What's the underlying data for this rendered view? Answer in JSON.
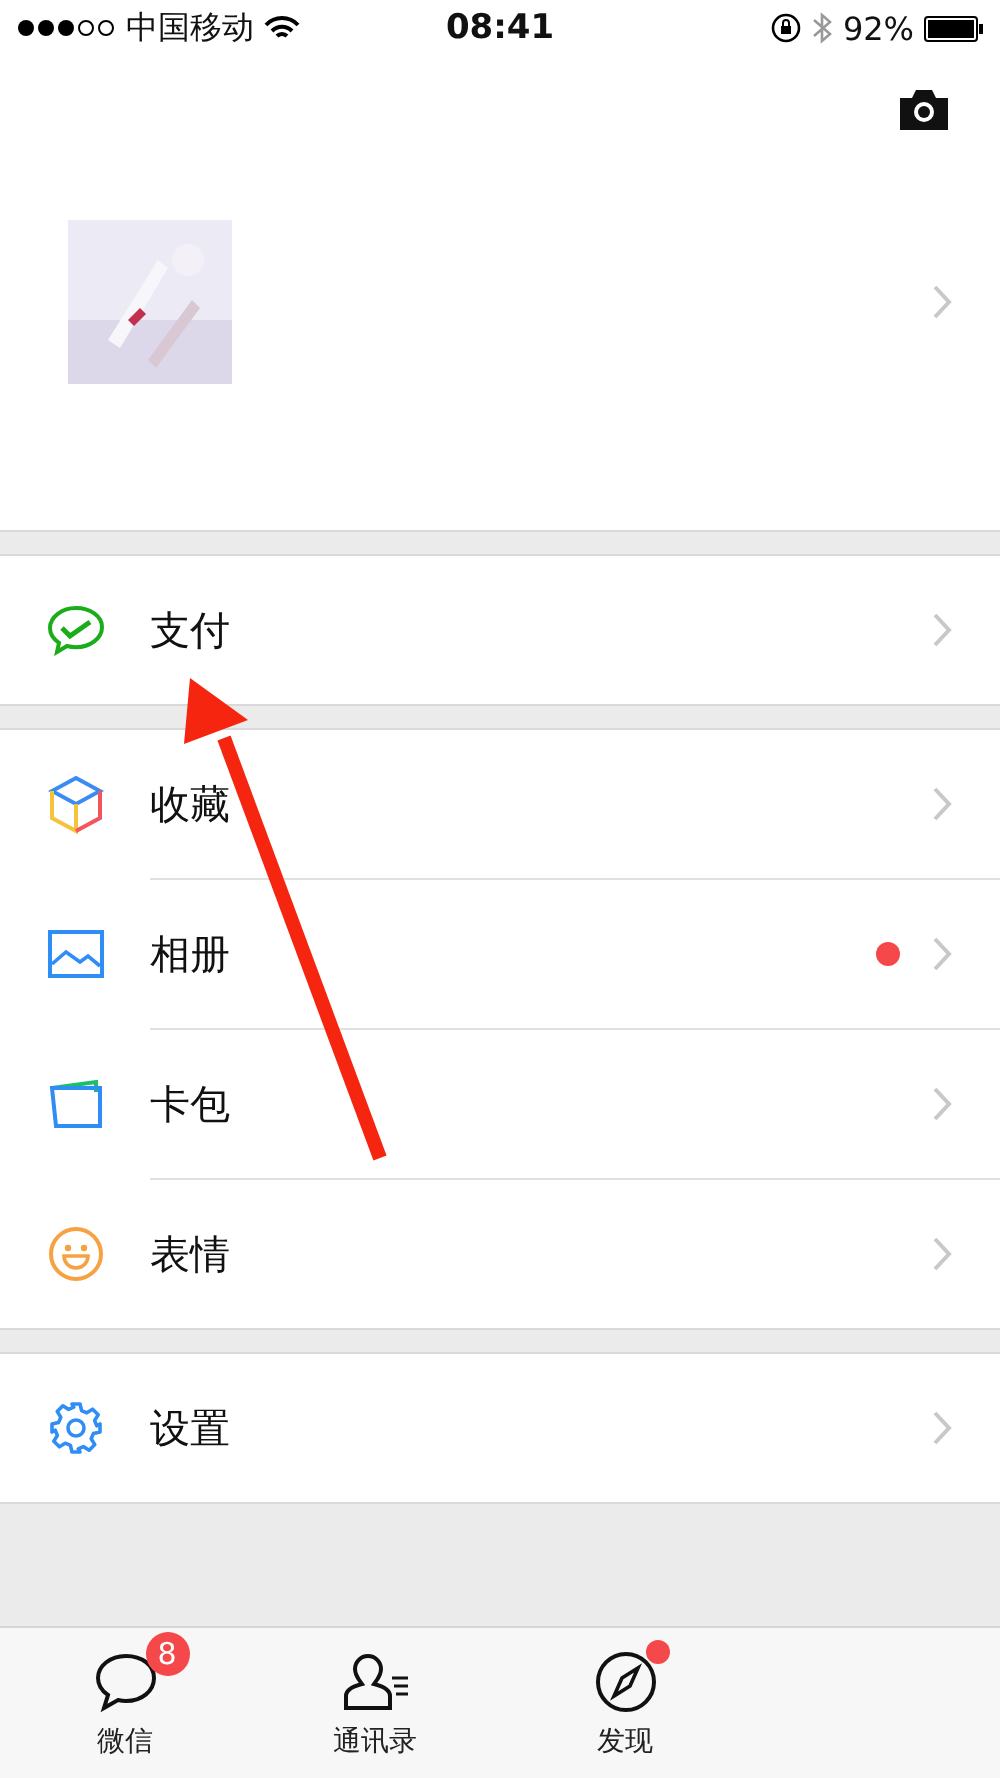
{
  "status_bar": {
    "carrier": "中国移动",
    "time": "08:41",
    "battery": "92%"
  },
  "sections": [
    [
      {
        "label": "支付",
        "kind": "pay",
        "dot": false
      }
    ],
    [
      {
        "label": "收藏",
        "kind": "favorites",
        "dot": false
      },
      {
        "label": "相册",
        "kind": "album",
        "dot": true
      },
      {
        "label": "卡包",
        "kind": "cards",
        "dot": false
      },
      {
        "label": "表情",
        "kind": "stickers",
        "dot": false
      }
    ],
    [
      {
        "label": "设置",
        "kind": "settings",
        "dot": false
      }
    ]
  ],
  "tabs": [
    {
      "label": "微信",
      "kind": "chat",
      "badge": "8",
      "dot": false,
      "selected": false
    },
    {
      "label": "通讯录",
      "kind": "contacts",
      "dot": false,
      "selected": false
    },
    {
      "label": "发现",
      "kind": "discover",
      "dot": true,
      "selected": false
    }
  ]
}
